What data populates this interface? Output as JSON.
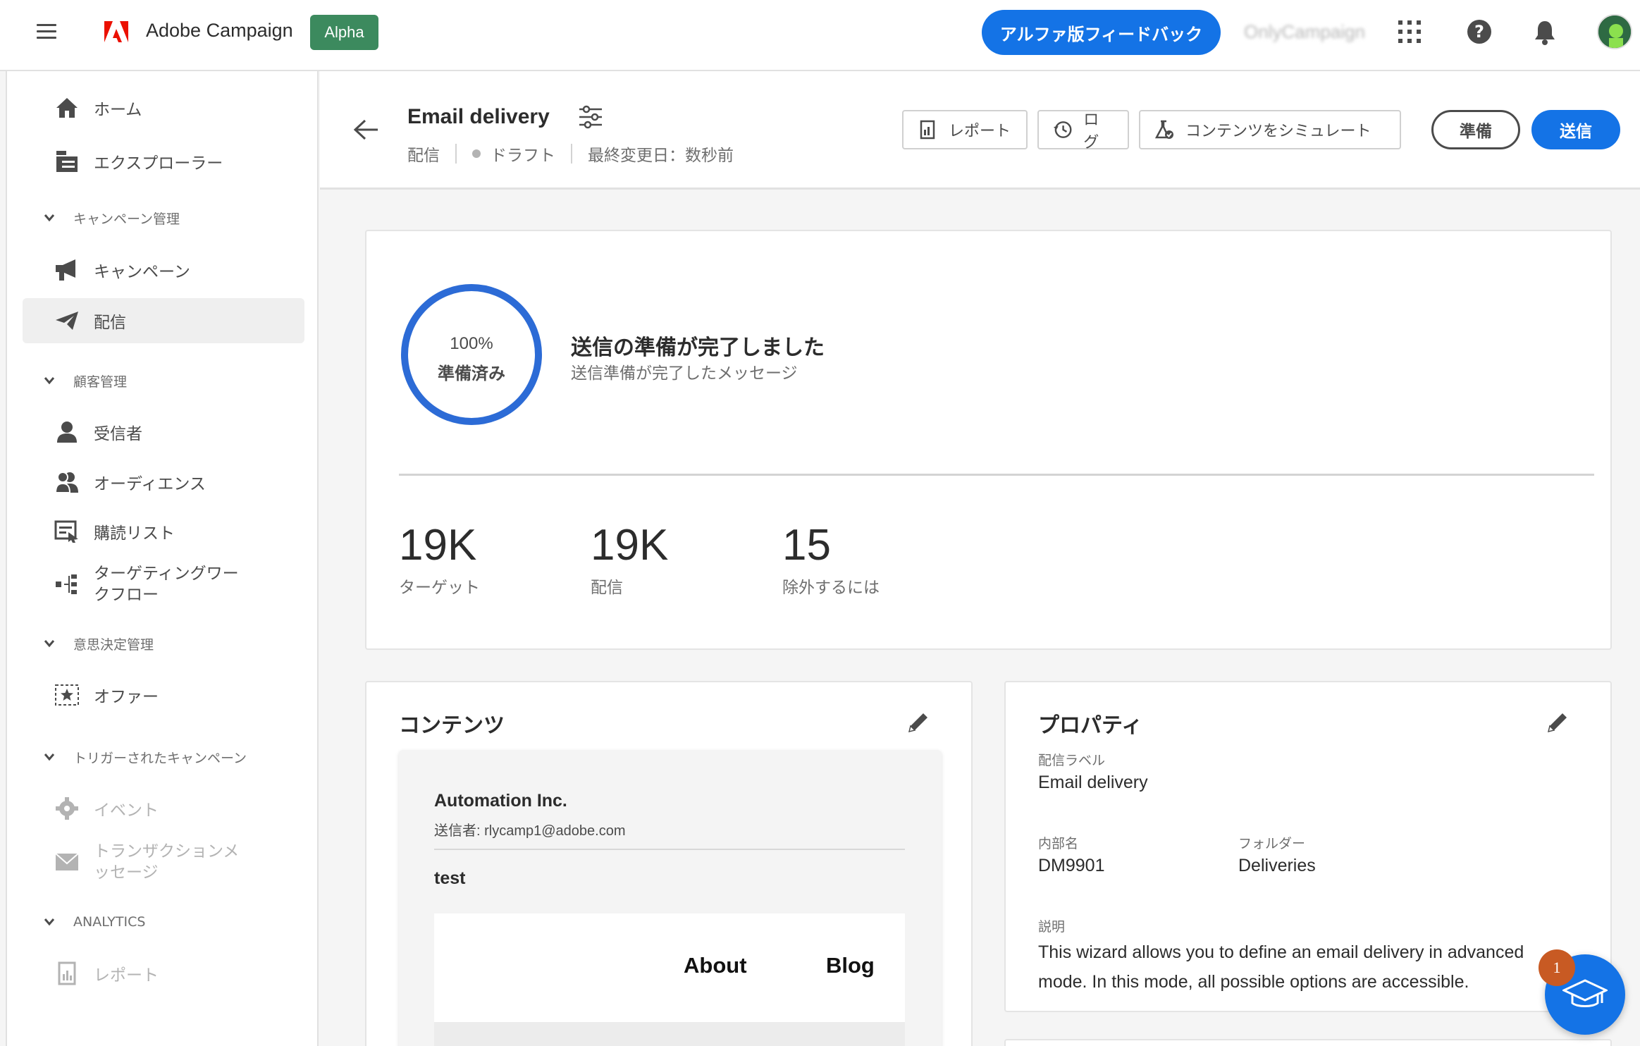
{
  "topbar": {
    "app_title": "Adobe Campaign",
    "badge": "Alpha",
    "feedback_label": "アルファ版フィードバック",
    "org_name": "OnlyCampaign",
    "help_glyph": "?"
  },
  "sidebar": {
    "items": {
      "home": "ホーム",
      "explorer": "エクスプローラー",
      "campaign_section": "キャンペーン管理",
      "campaigns": "キャンペーン",
      "deliveries": "配信",
      "customer_section": "顧客管理",
      "recipients": "受信者",
      "audiences": "オーディエンス",
      "subscriptions": "購読リスト",
      "targeting_line1": "ターゲティングワー",
      "targeting_line2": "クフロー",
      "decision_section": "意思決定管理",
      "offers": "オファー",
      "triggered_section": "トリガーされたキャンペーン",
      "events": "イベント",
      "transactional_line1": "トランザクションメ",
      "transactional_line2": "ッセージ",
      "analytics_section": "ANALYTICS",
      "reports": "レポート"
    }
  },
  "header": {
    "title": "Email delivery",
    "type": "配信",
    "status": "ドラフト",
    "modified": "最終変更日：数秒前",
    "report_btn": "レポート",
    "log_btn": "ログ",
    "simulate_btn": "コンテンツをシミュレート",
    "prepare_btn": "準備",
    "send_btn": "送信"
  },
  "status": {
    "percent": "100%",
    "ring_label": "準備済み",
    "progress": 1.0,
    "title": "送信の準備が完了しました",
    "subtitle": "送信準備が完了したメッセージ",
    "stats": [
      {
        "value": "19K",
        "label": "ターゲット"
      },
      {
        "value": "19K",
        "label": "配信"
      },
      {
        "value": "15",
        "label": "除外するには"
      }
    ]
  },
  "content": {
    "title": "コンテンツ",
    "sender_name": "Automation Inc.",
    "from": "送信者: rlycamp1@adobe.com",
    "subject": "test",
    "links": [
      "About",
      "Blog"
    ]
  },
  "properties": {
    "title": "プロパティ",
    "label_caption": "配信ラベル",
    "label_value": "Email delivery",
    "internal_caption": "内部名",
    "internal_value": "DM9901",
    "folder_caption": "フォルダー",
    "folder_value": "Deliveries",
    "desc_caption": "説明",
    "desc_value": "This wizard allows you to define an email delivery in advanced mode. In this mode, all possible options are accessible."
  },
  "learn": {
    "badge_count": "1"
  },
  "colors": {
    "accent": "#1473e6",
    "ring": "#2c6bd6",
    "alpha_badge": "#3c8a5e",
    "notification": "#c85a23"
  }
}
